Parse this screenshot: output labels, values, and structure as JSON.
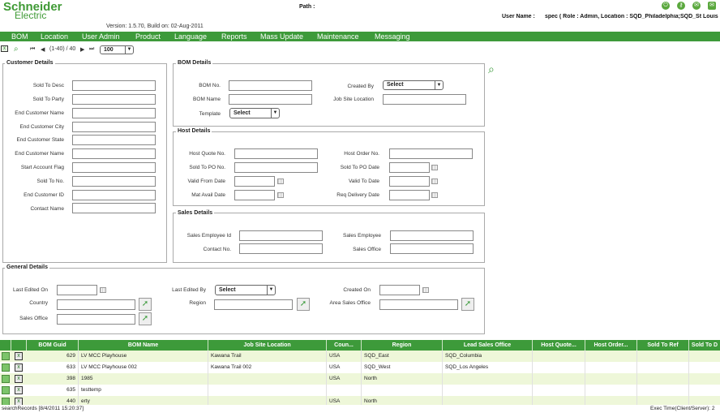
{
  "header": {
    "logo_line1": "Schneider",
    "logo_line2": "Electric",
    "path_label": "Path :",
    "version": "Version: 1.5.70, Build on: 02-Aug-2011",
    "user_label": "User Name :",
    "user_value": "spec ( Role : Admin, Location : SQD_Philadelphia;SQD_St Louis"
  },
  "menu": [
    "BOM",
    "Location",
    "User Admin",
    "Product",
    "Language",
    "Reports",
    "Mass Update",
    "Maintenance",
    "Messaging"
  ],
  "toolbar": {
    "range": "(1-40) / 40",
    "page_size": "100"
  },
  "customer": {
    "title": "Customer Details",
    "fields": [
      "Sold To Desc",
      "Sold To Party",
      "End Customer Name",
      "End Customer City",
      "End Customer State",
      "End Customer Name",
      "Start Account Flag",
      "Sold To No.",
      "End Customer ID",
      "Contact Name"
    ]
  },
  "bom": {
    "title": "BOM Details",
    "bom_no": "BOM No.",
    "created_by": "Created By",
    "created_by_value": "Select",
    "bom_name": "BOM Name",
    "job_site": "Job Site Location",
    "template": "Template",
    "template_value": "Select"
  },
  "host": {
    "title": "Host Details",
    "host_quote": "Host Quote No.",
    "host_order": "Host Order No.",
    "sold_po_no": "Sold To PO No.",
    "sold_po_date": "Sold To PO Date",
    "valid_from": "Valid From Date",
    "valid_to": "Valid To Date",
    "mat_avail": "Mat Avail Date",
    "req_delivery": "Req Delivery Date"
  },
  "sales": {
    "title": "Sales Details",
    "emp_id": "Sales Employee Id",
    "employee": "Sales Employee",
    "contact": "Contact No.",
    "office": "Sales Office"
  },
  "general": {
    "title": "General Details",
    "last_edited_on": "Last Edited On",
    "last_edited_by": "Last Edited By",
    "last_edited_by_value": "Select",
    "created_on": "Created On",
    "country": "Country",
    "region": "Region",
    "area_sales_office": "Area Sales Office",
    "sales_office": "Sales Office"
  },
  "grid": {
    "columns": [
      "BOM Guid",
      "BOM Name",
      "Job Site Location",
      "Coun...",
      "Region",
      "Lead Sales Office",
      "Host Quote...",
      "Host Order...",
      "Sold To Ref",
      "Sold To D"
    ],
    "rows": [
      [
        "629",
        "LV MCC Playhouse",
        "Kawana Trail",
        "USA",
        "SQD_East",
        "SQD_Columbia"
      ],
      [
        "633",
        "LV MCC Playhouse 002",
        "Kawana Trail 002",
        "USA",
        "SQD_West",
        "SQD_Los Angeles"
      ],
      [
        "398",
        "1985",
        "",
        "USA",
        "North",
        ""
      ],
      [
        "635",
        "testtemp",
        "",
        "",
        "",
        ""
      ],
      [
        "440",
        "erty",
        "",
        "USA",
        "North",
        ""
      ]
    ]
  },
  "status": {
    "left": "searchRecords [8/4/2011 15:20:37]",
    "right": "Exec Time(Client/Server): 2"
  }
}
